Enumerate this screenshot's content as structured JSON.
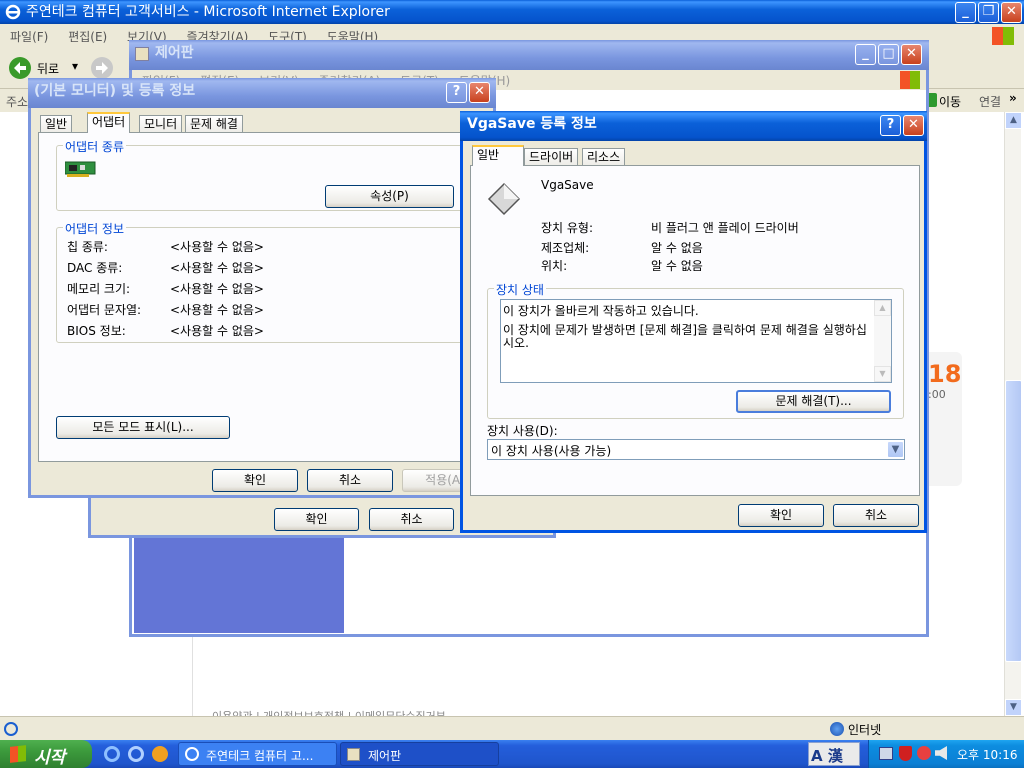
{
  "ie": {
    "title": "주연테크 컴퓨터 고객서비스 - Microsoft Internet Explorer",
    "menu": [
      "파일(F)",
      "편집(E)",
      "보기(V)",
      "즐겨찾기(A)",
      "도구(T)",
      "도움말(H)"
    ],
    "back_label": "뒤로",
    "address_label": "주소",
    "go_label": "이동",
    "links_label": "연결",
    "status_zone": "인터넷",
    "footer_text": "이용약관 | 개인정보보호정책 | 이메일무단수집거부",
    "promo_number": "18",
    "promo_sub": ":00"
  },
  "controlpanel": {
    "title": "제어판",
    "menu": [
      "파일(F)",
      "편집(E)",
      "보기(V)",
      "즐겨찾기(A)",
      "도구(T)",
      "도움말(H)"
    ],
    "ok": "확인",
    "cancel": "취소"
  },
  "monitor_dialog": {
    "title": "(기본 모니터) 및  등록 정보",
    "tabs": [
      "일반",
      "어댑터",
      "모니터",
      "문제 해결"
    ],
    "adapter_type_label": "어댑터 종류",
    "properties_button": "속성(P)",
    "adapter_info_label": "어댑터 정보",
    "info_rows": [
      {
        "k": "칩 종류:",
        "v": "<사용할 수 없음>"
      },
      {
        "k": "DAC 종류:",
        "v": "<사용할 수 없음>"
      },
      {
        "k": "메모리 크기:",
        "v": "<사용할 수 없음>"
      },
      {
        "k": "어댑터 문자열:",
        "v": "<사용할 수 없음>"
      },
      {
        "k": "BIOS 정보:",
        "v": "<사용할 수 없음>"
      }
    ],
    "list_all_modes": "모든 모드 표시(L)...",
    "ok": "확인",
    "cancel": "취소",
    "apply": "적용(A)"
  },
  "vga_dialog": {
    "title": "VgaSave 등록 정보",
    "tabs": [
      "일반",
      "드라이버",
      "리소스"
    ],
    "device_name": "VgaSave",
    "rows": [
      {
        "k": "장치 유형:",
        "v": "비 플러그 앤 플레이 드라이버"
      },
      {
        "k": "제조업체:",
        "v": "알 수 없음"
      },
      {
        "k": "위치:",
        "v": "알 수 없음"
      }
    ],
    "status_label": "장치 상태",
    "status_line1": "이 장치가 올바르게 작동하고 있습니다.",
    "status_line2": "이 장치에 문제가 발생하면 [문제 해결]을 클릭하여 문제 해결을 실행하십시오.",
    "troubleshoot_button": "문제 해결(T)...",
    "usage_label": "장치 사용(D):",
    "usage_value": "이 장치 사용(사용 가능)",
    "ok": "확인",
    "cancel": "취소"
  },
  "taskbar": {
    "start": "시작",
    "tasks": [
      "주연테크 컴퓨터 고...",
      "제어판"
    ],
    "ime": "A 漢",
    "clock": "오후 10:16"
  },
  "colors": {
    "xp_blue": "#0054e3",
    "taskbar": "#245edb",
    "start_green": "#3c9a3c",
    "promo_orange": "#f26b1d"
  }
}
